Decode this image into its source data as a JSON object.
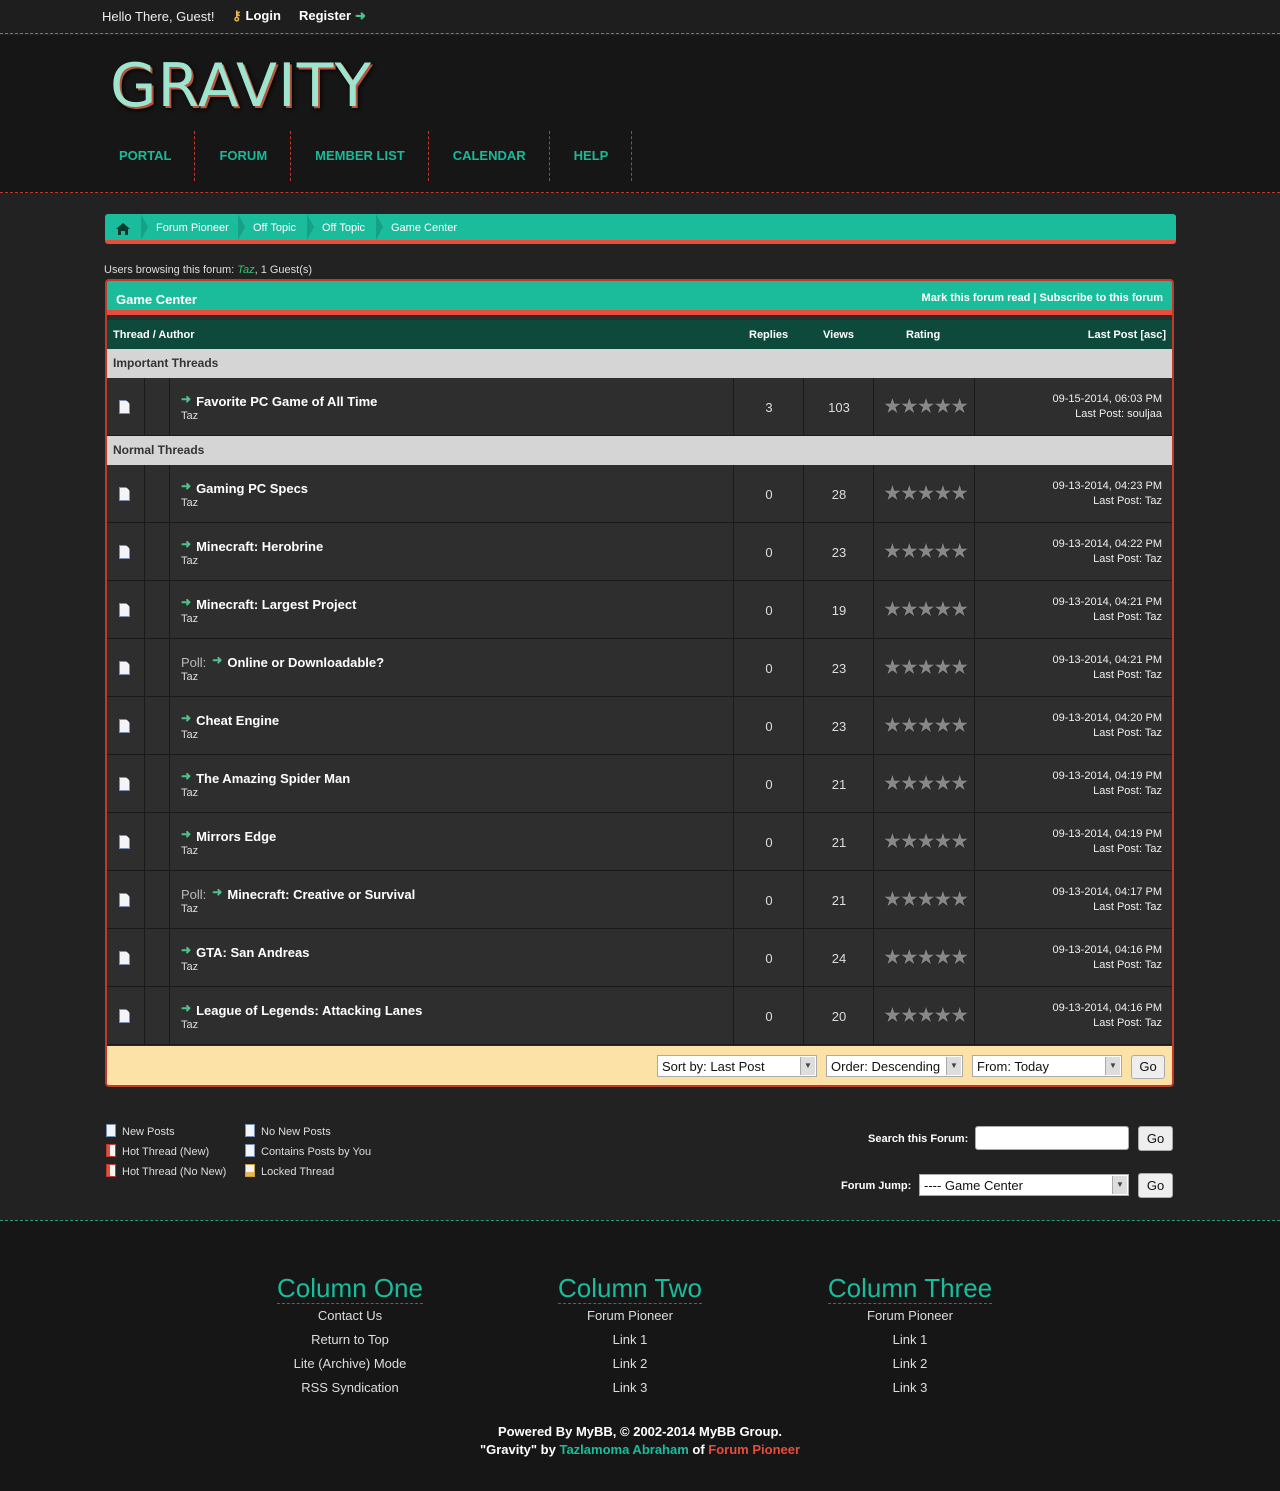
{
  "top_bar": {
    "greeting": "Hello There, Guest!",
    "login": "Login",
    "register": "Register"
  },
  "logo": "GRAVITY",
  "nav": [
    "PORTAL",
    "FORUM",
    "MEMBER LIST",
    "CALENDAR",
    "HELP"
  ],
  "breadcrumb": [
    "Forum Pioneer",
    "Off Topic",
    "Off Topic",
    "Game Center"
  ],
  "browsing": {
    "prefix": "Users browsing this forum: ",
    "user": "Taz",
    "suffix": ", 1 Guest(s)"
  },
  "forum": {
    "title": "Game Center",
    "options": "Mark this forum read | Subscribe to this forum",
    "columns": {
      "thread": "Thread / Author",
      "replies": "Replies",
      "views": "Views",
      "rating": "Rating",
      "lastpost": "Last Post [asc]"
    },
    "important_label": "Important Threads",
    "normal_label": "Normal Threads",
    "important": [
      {
        "poll": "",
        "title": "Favorite PC Game of All Time",
        "author": "Taz",
        "replies": "3",
        "views": "103",
        "date": "09-15-2014, 06:03 PM",
        "last": "Last Post: souljaa"
      }
    ],
    "normal": [
      {
        "poll": "",
        "title": "Gaming PC Specs",
        "author": "Taz",
        "replies": "0",
        "views": "28",
        "date": "09-13-2014, 04:23 PM",
        "last": "Last Post: Taz"
      },
      {
        "poll": "",
        "title": "Minecraft: Herobrine",
        "author": "Taz",
        "replies": "0",
        "views": "23",
        "date": "09-13-2014, 04:22 PM",
        "last": "Last Post: Taz"
      },
      {
        "poll": "",
        "title": "Minecraft: Largest Project",
        "author": "Taz",
        "replies": "0",
        "views": "19",
        "date": "09-13-2014, 04:21 PM",
        "last": "Last Post: Taz"
      },
      {
        "poll": "Poll:",
        "title": "Online or Downloadable?",
        "author": "Taz",
        "replies": "0",
        "views": "23",
        "date": "09-13-2014, 04:21 PM",
        "last": "Last Post: Taz"
      },
      {
        "poll": "",
        "title": "Cheat Engine",
        "author": "Taz",
        "replies": "0",
        "views": "23",
        "date": "09-13-2014, 04:20 PM",
        "last": "Last Post: Taz"
      },
      {
        "poll": "",
        "title": "The Amazing Spider Man",
        "author": "Taz",
        "replies": "0",
        "views": "21",
        "date": "09-13-2014, 04:19 PM",
        "last": "Last Post: Taz"
      },
      {
        "poll": "",
        "title": "Mirrors Edge",
        "author": "Taz",
        "replies": "0",
        "views": "21",
        "date": "09-13-2014, 04:19 PM",
        "last": "Last Post: Taz"
      },
      {
        "poll": "Poll:",
        "title": "Minecraft: Creative or Survival",
        "author": "Taz",
        "replies": "0",
        "views": "21",
        "date": "09-13-2014, 04:17 PM",
        "last": "Last Post: Taz"
      },
      {
        "poll": "",
        "title": "GTA: San Andreas",
        "author": "Taz",
        "replies": "0",
        "views": "24",
        "date": "09-13-2014, 04:16 PM",
        "last": "Last Post: Taz"
      },
      {
        "poll": "",
        "title": "League of Legends: Attacking Lanes",
        "author": "Taz",
        "replies": "0",
        "views": "20",
        "date": "09-13-2014, 04:16 PM",
        "last": "Last Post: Taz"
      }
    ],
    "sort": {
      "sort_by": "Sort by: Last Post",
      "order": "Order: Descending",
      "from": "From: Today",
      "go": "Go"
    }
  },
  "legend": [
    "New Posts",
    "No New Posts",
    "Hot Thread (New)",
    "Contains Posts by You",
    "Hot Thread (No New)",
    "Locked Thread"
  ],
  "search": {
    "label": "Search this Forum:",
    "value": "",
    "go": "Go"
  },
  "jump": {
    "label": "Forum Jump:",
    "value": "---- Game Center",
    "go": "Go"
  },
  "footer": {
    "columns": [
      {
        "title": "Column One",
        "links": [
          "Contact Us",
          "Return to Top",
          "Lite (Archive) Mode",
          "RSS Syndication"
        ]
      },
      {
        "title": "Column Two",
        "links": [
          "Forum Pioneer",
          "Link 1",
          "Link 2",
          "Link 3"
        ]
      },
      {
        "title": "Column Three",
        "links": [
          "Forum Pioneer",
          "Link 1",
          "Link 2",
          "Link 3"
        ]
      }
    ],
    "powered": "Powered By MyBB, © 2002-2014 MyBB Group.",
    "credit_a": "\"Gravity\" by ",
    "credit_author": "Tazlamoma Abraham",
    "credit_b": " of ",
    "credit_site": "Forum Pioneer"
  }
}
